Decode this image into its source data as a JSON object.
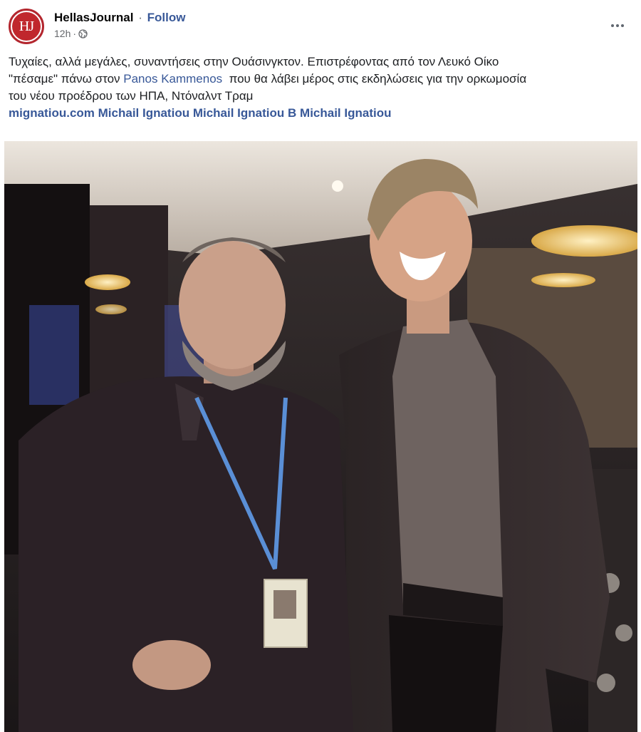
{
  "post": {
    "page_name": "HellasJournal",
    "separator": "·",
    "follow_label": "Follow",
    "timestamp": "12h",
    "meta_separator": "·",
    "avatar_initials": "HJ",
    "privacy_icon": "globe-icon",
    "more_icon": "more-options-icon",
    "text": {
      "line1": "Τυχαίες, αλλά μεγάλες, συναντήσεις στην Ουάσινγκτον. Επιστρέφοντας από τον Λευκό Οίκο",
      "line2_before": "\"πέσαμε\" πάνω στον ",
      "mention": "Panos Kammenos",
      "line2_after": "  που θα λάβει μέρος στις εκδηλώσεις για την ορκωμοσία",
      "line3": "του νέου προέδρου των ΗΠΑ, Ντόναλντ Τραμ"
    },
    "links": [
      "mignatiou.com",
      "Michail Ignatiou",
      "Michail Ignatiou",
      "B",
      "Michail Ignatiou"
    ]
  },
  "colors": {
    "brand_red": "#c0272d",
    "link_blue": "#385898",
    "meta_gray": "#65676b"
  }
}
